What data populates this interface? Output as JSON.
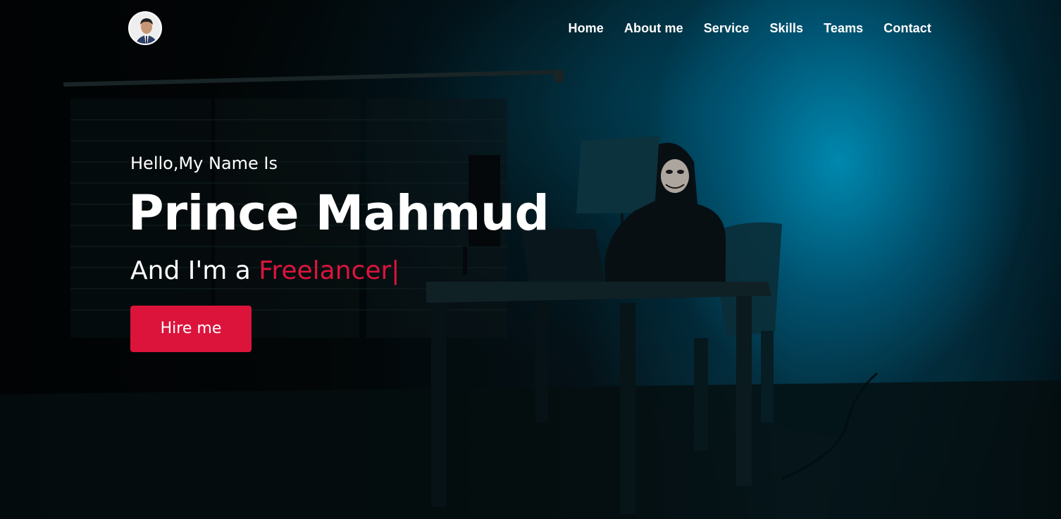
{
  "nav": {
    "avatar_icon": "profile-photo-avatar",
    "links": [
      "Home",
      "About me",
      "Service",
      "Skills",
      "Teams",
      "Contact"
    ]
  },
  "hero": {
    "greeting": "Hello,My Name Is",
    "name": "Prince Mahmud",
    "role_prefix": "And I'm a",
    "role_highlight": "Freelancer",
    "cursor": "|",
    "cta_label": "Hire me"
  },
  "colors": {
    "accent": "#dc143c",
    "text": "#ffffff",
    "background_glow": "#00a0cd"
  }
}
